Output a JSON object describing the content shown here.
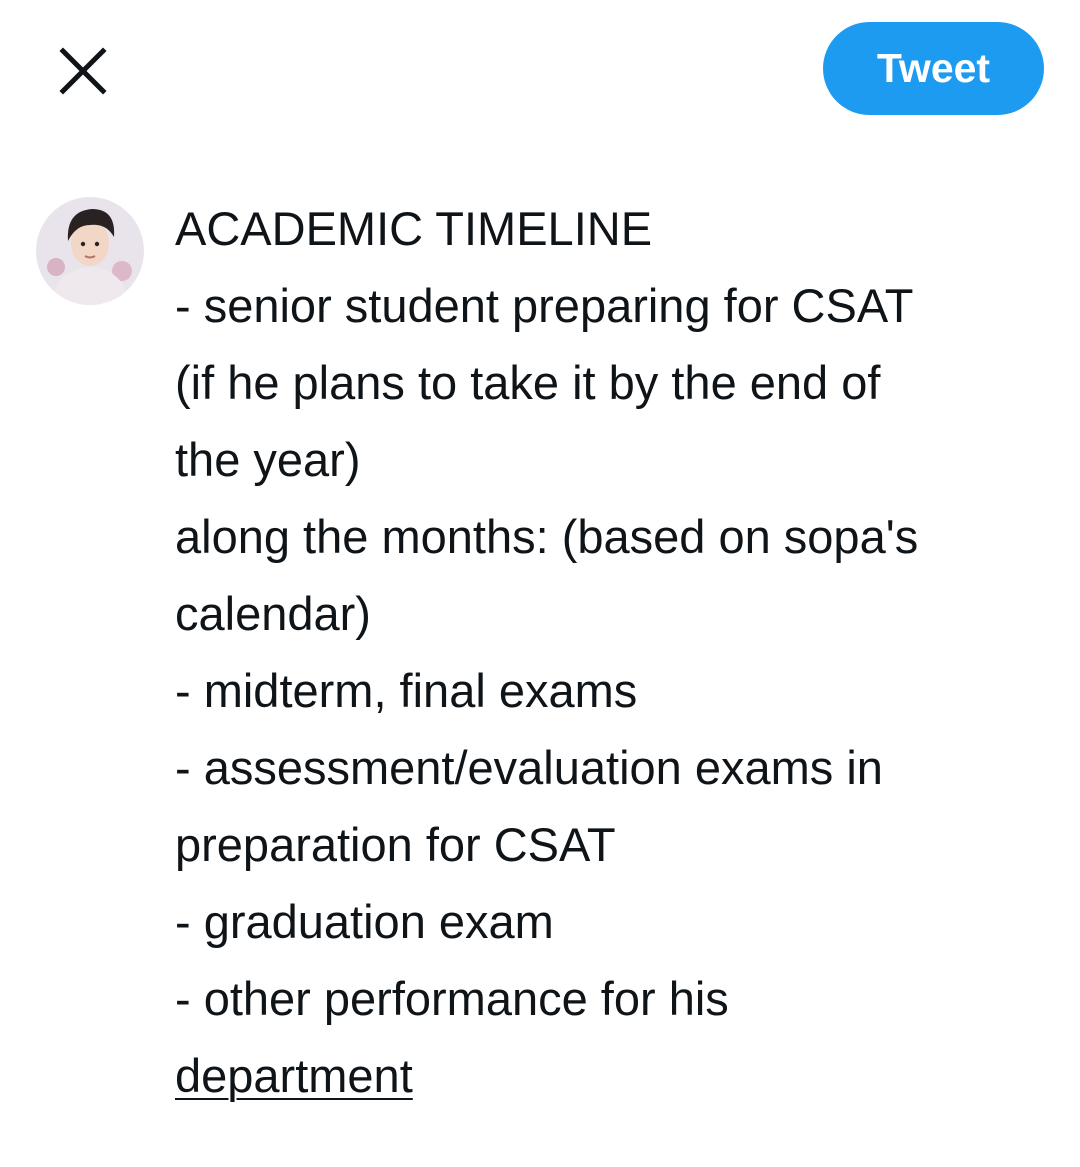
{
  "header": {
    "close_icon": "close-icon",
    "tweet_label": "Tweet",
    "accent_color": "#1d9bf0"
  },
  "composer": {
    "avatar_icon": "user-avatar",
    "lines": [
      "ACADEMIC TIMELINE",
      "- senior student preparing for CSAT",
      "(if he plans to take it by the end of",
      "the year)",
      "along the months: (based on sopa's",
      "calendar)",
      "- midterm, final exams",
      "- assessment/evaluation exams in",
      "preparation for CSAT",
      "- graduation exam",
      "- other performance for his"
    ],
    "underlined_word": "department"
  }
}
